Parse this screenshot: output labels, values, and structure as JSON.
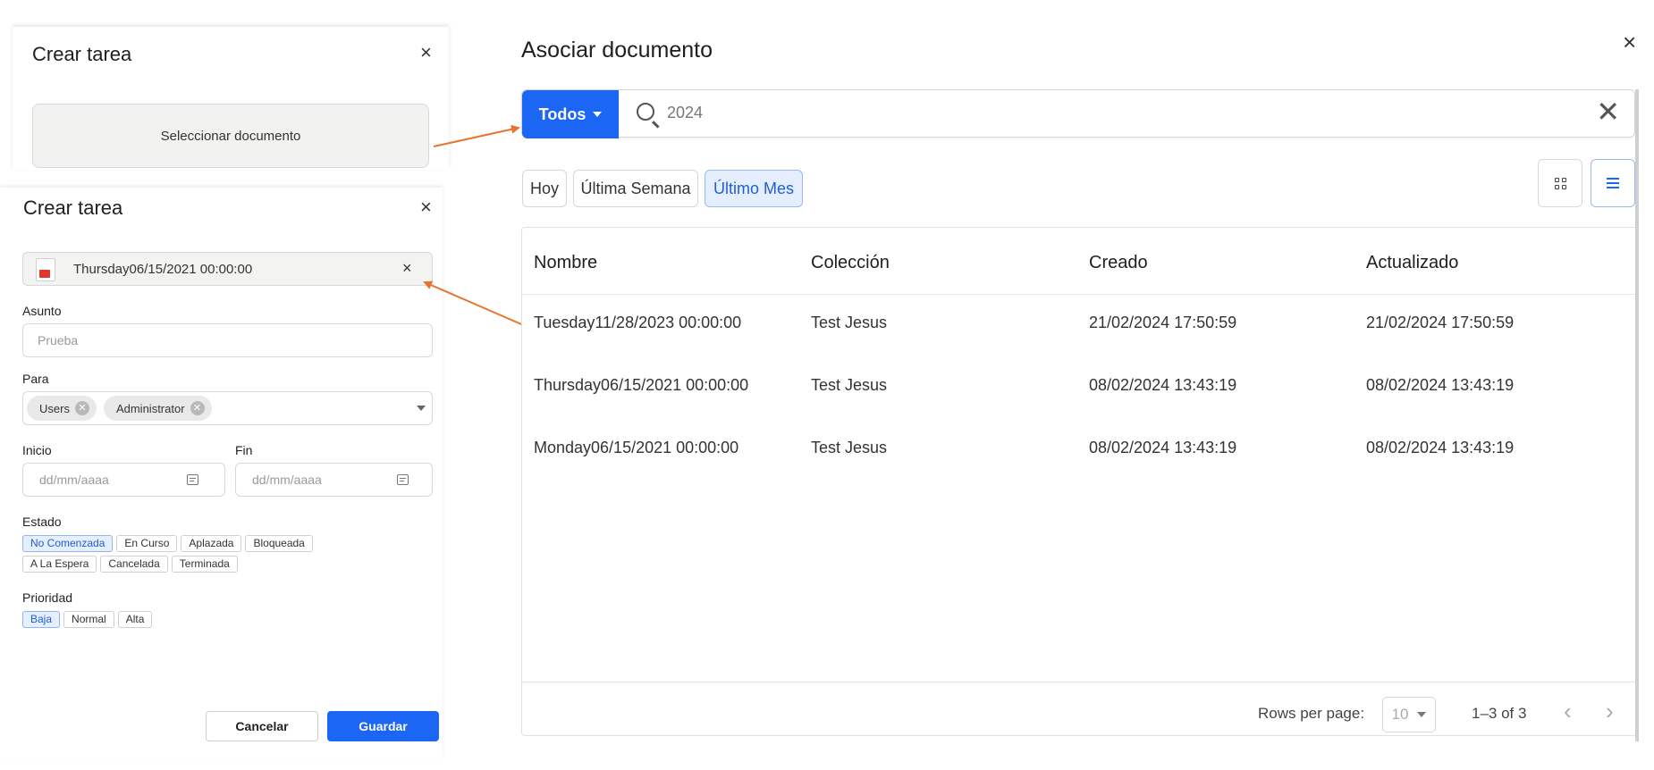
{
  "create_task_top": {
    "title": "Crear tarea",
    "close": "×",
    "select_document": "Seleccionar documento"
  },
  "create_task": {
    "title": "Crear tarea",
    "close": "×",
    "document": {
      "name": "Thursday06/15/2021 00:00:00",
      "remove": "×",
      "icon": "pdf-icon"
    },
    "subject": {
      "label": "Asunto",
      "placeholder": "Prueba"
    },
    "to": {
      "label": "Para",
      "chips": [
        "Users",
        "Administrator"
      ]
    },
    "start": {
      "label": "Inicio",
      "placeholder": "dd/mm/aaaa"
    },
    "end": {
      "label": "Fin",
      "placeholder": "dd/mm/aaaa"
    },
    "status": {
      "label": "Estado",
      "options": [
        "No Comenzada",
        "En Curso",
        "Aplazada",
        "Bloqueada",
        "A La Espera",
        "Cancelada",
        "Terminada"
      ],
      "selected": "No Comenzada"
    },
    "priority": {
      "label": "Prioridad",
      "options": [
        "Baja",
        "Normal",
        "Alta"
      ],
      "selected": "Baja"
    },
    "cancel_label": "Cancelar",
    "save_label": "Guardar"
  },
  "associate": {
    "title": "Asociar documento",
    "close": "×",
    "scope_label": "Todos",
    "search_value": "2024",
    "clear": "✕",
    "filters": [
      "Hoy",
      "Última Semana",
      "Último Mes"
    ],
    "selected_filter": "Último Mes",
    "view_modes": [
      "grid",
      "list"
    ],
    "active_view": "list",
    "columns": [
      "Nombre",
      "Colección",
      "Creado",
      "Actualizado"
    ],
    "rows": [
      [
        "Tuesday11/28/2023 00:00:00",
        "Test Jesus",
        "21/02/2024 17:50:59",
        "21/02/2024 17:50:59"
      ],
      [
        "Thursday06/15/2021 00:00:00",
        "Test Jesus",
        "08/02/2024 13:43:19",
        "08/02/2024 13:43:19"
      ],
      [
        "Monday06/15/2021 00:00:00",
        "Test Jesus",
        "08/02/2024 13:43:19",
        "08/02/2024 13:43:19"
      ]
    ],
    "pagination": {
      "rows_per_page_label": "Rows per page:",
      "rows_per_page": "10",
      "range": "1–3 of 3",
      "prev": "‹",
      "next": "›"
    }
  },
  "colors": {
    "accent": "#1b66f5",
    "arrow": "#e8732f"
  }
}
